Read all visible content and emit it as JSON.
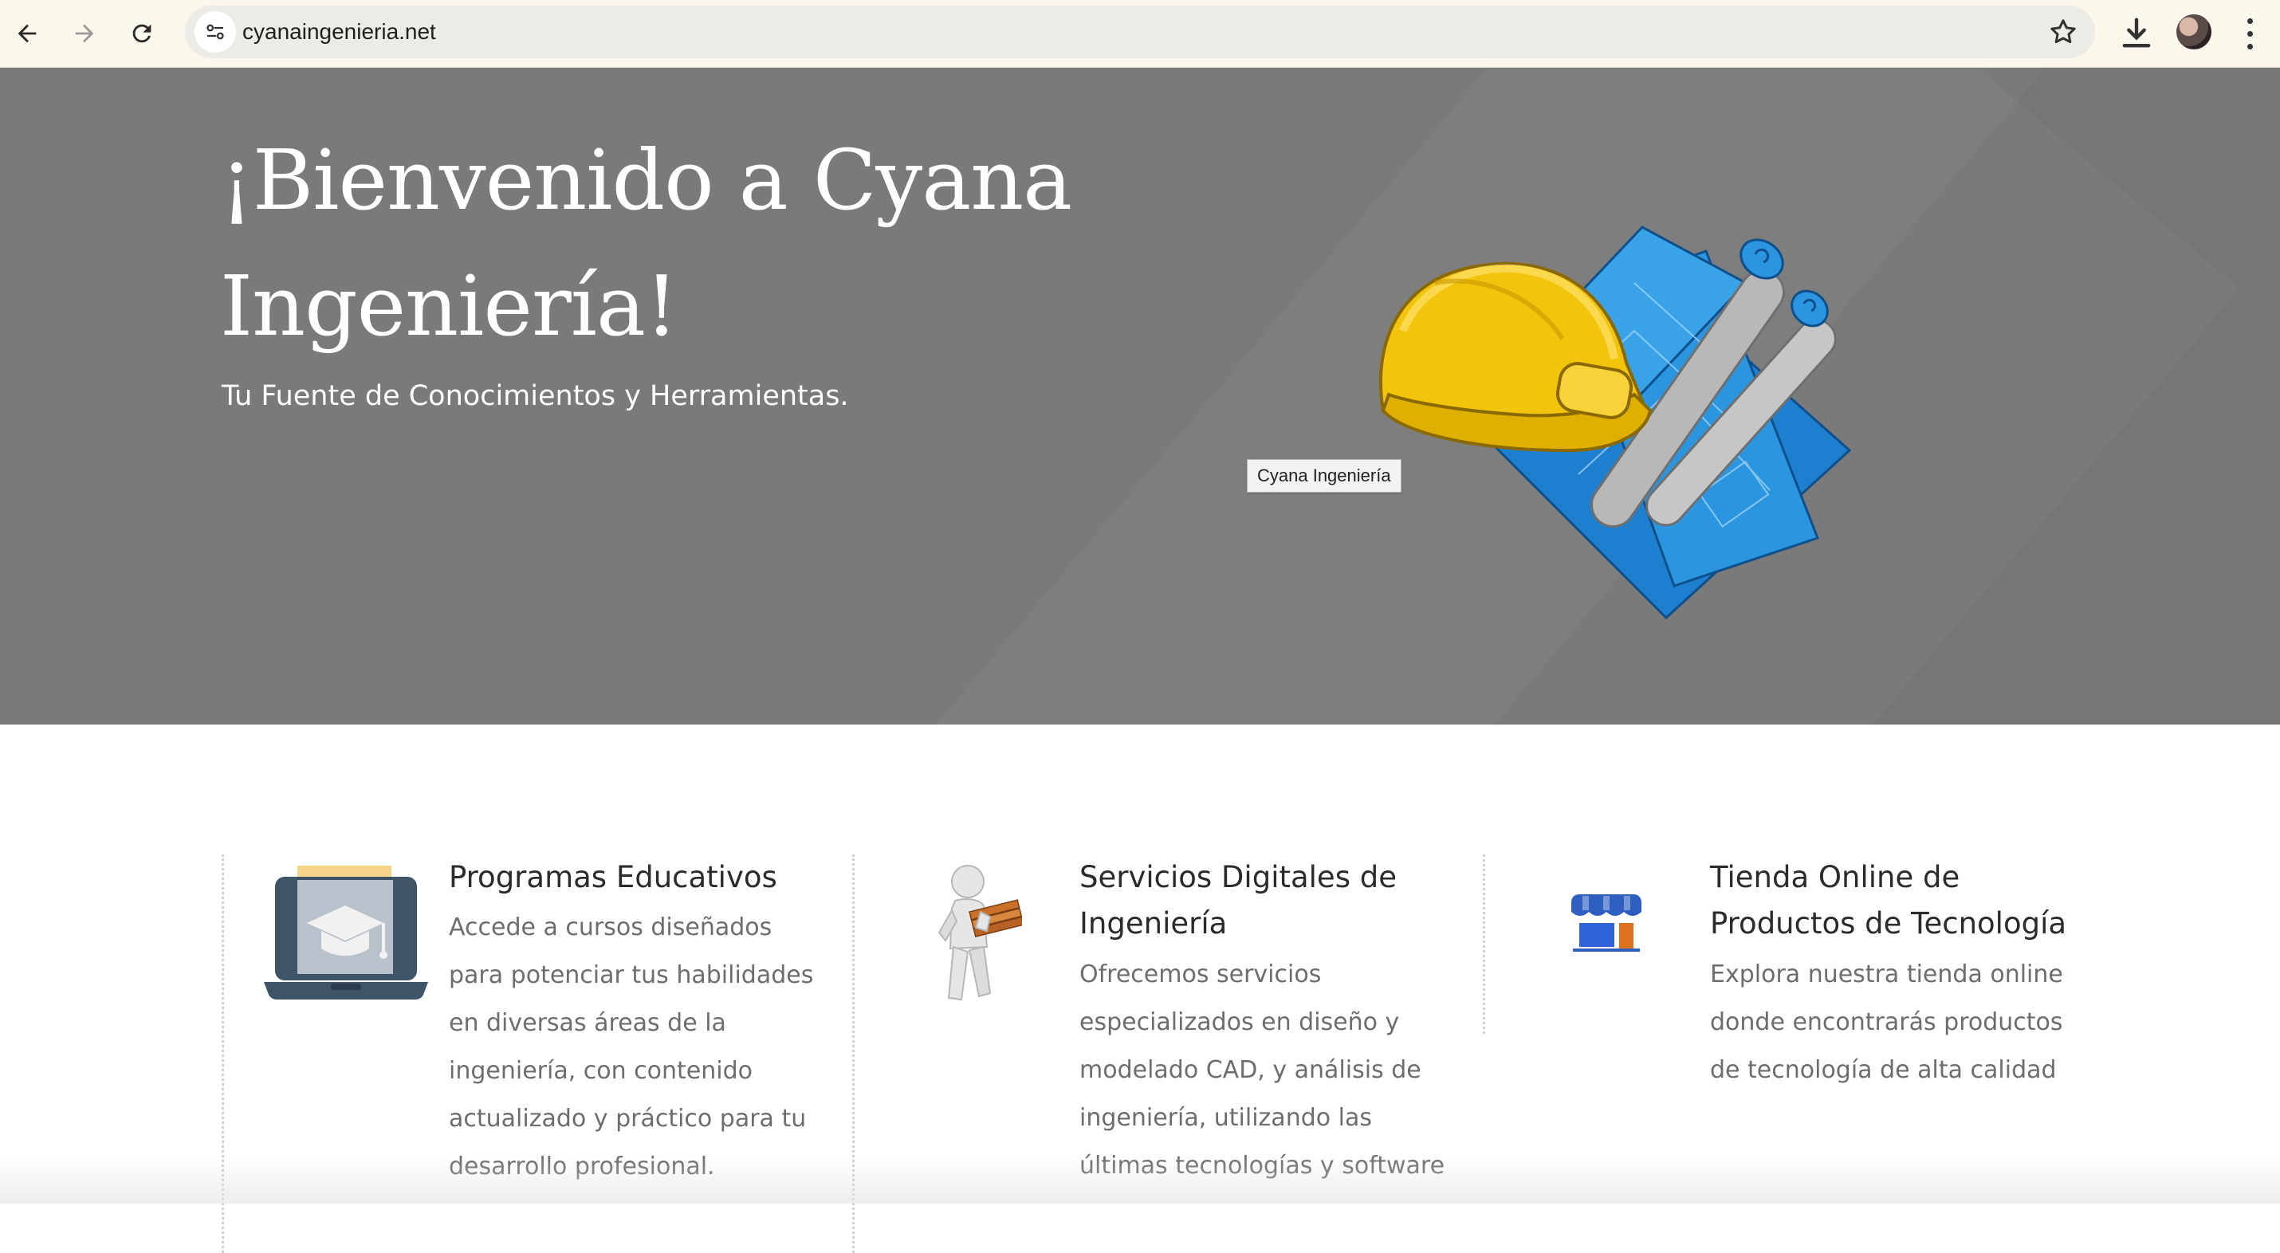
{
  "browser": {
    "url": "cyanaingenieria.net",
    "icons": [
      "back-arrow-icon",
      "forward-arrow-icon",
      "reload-icon",
      "site-info-icon",
      "bookmark-star-icon",
      "download-icon",
      "profile-avatar",
      "kebab-menu-icon"
    ]
  },
  "hero": {
    "title": "¡Bienvenido a Cyana Ingeniería!",
    "subtitle": "Tu Fuente de Conocimientos y Herramientas.",
    "image_tooltip": "Cyana Ingeniería",
    "background_color": "#7a7a7a"
  },
  "features": [
    {
      "title": "Programas Educativos",
      "description": "Accede a cursos diseñados para potenciar tus habilidades en diversas áreas de la ingeniería, con contenido actualizado y práctico para tu desarrollo profesional.",
      "icon": "laptop-graduation-cap-icon"
    },
    {
      "title": "Servicios Digitales de Ingeniería",
      "description": "Ofrecemos servicios especializados en diseño y modelado CAD, y análisis de ingeniería, utilizando las últimas tecnologías y software",
      "icon": "figure-carrying-planks-icon"
    },
    {
      "title": "Tienda Online de Productos de Tecnología",
      "description": "Explora nuestra tienda online donde encontrarás productos de tecnología de alta calidad",
      "icon": "storefront-icon"
    }
  ]
}
